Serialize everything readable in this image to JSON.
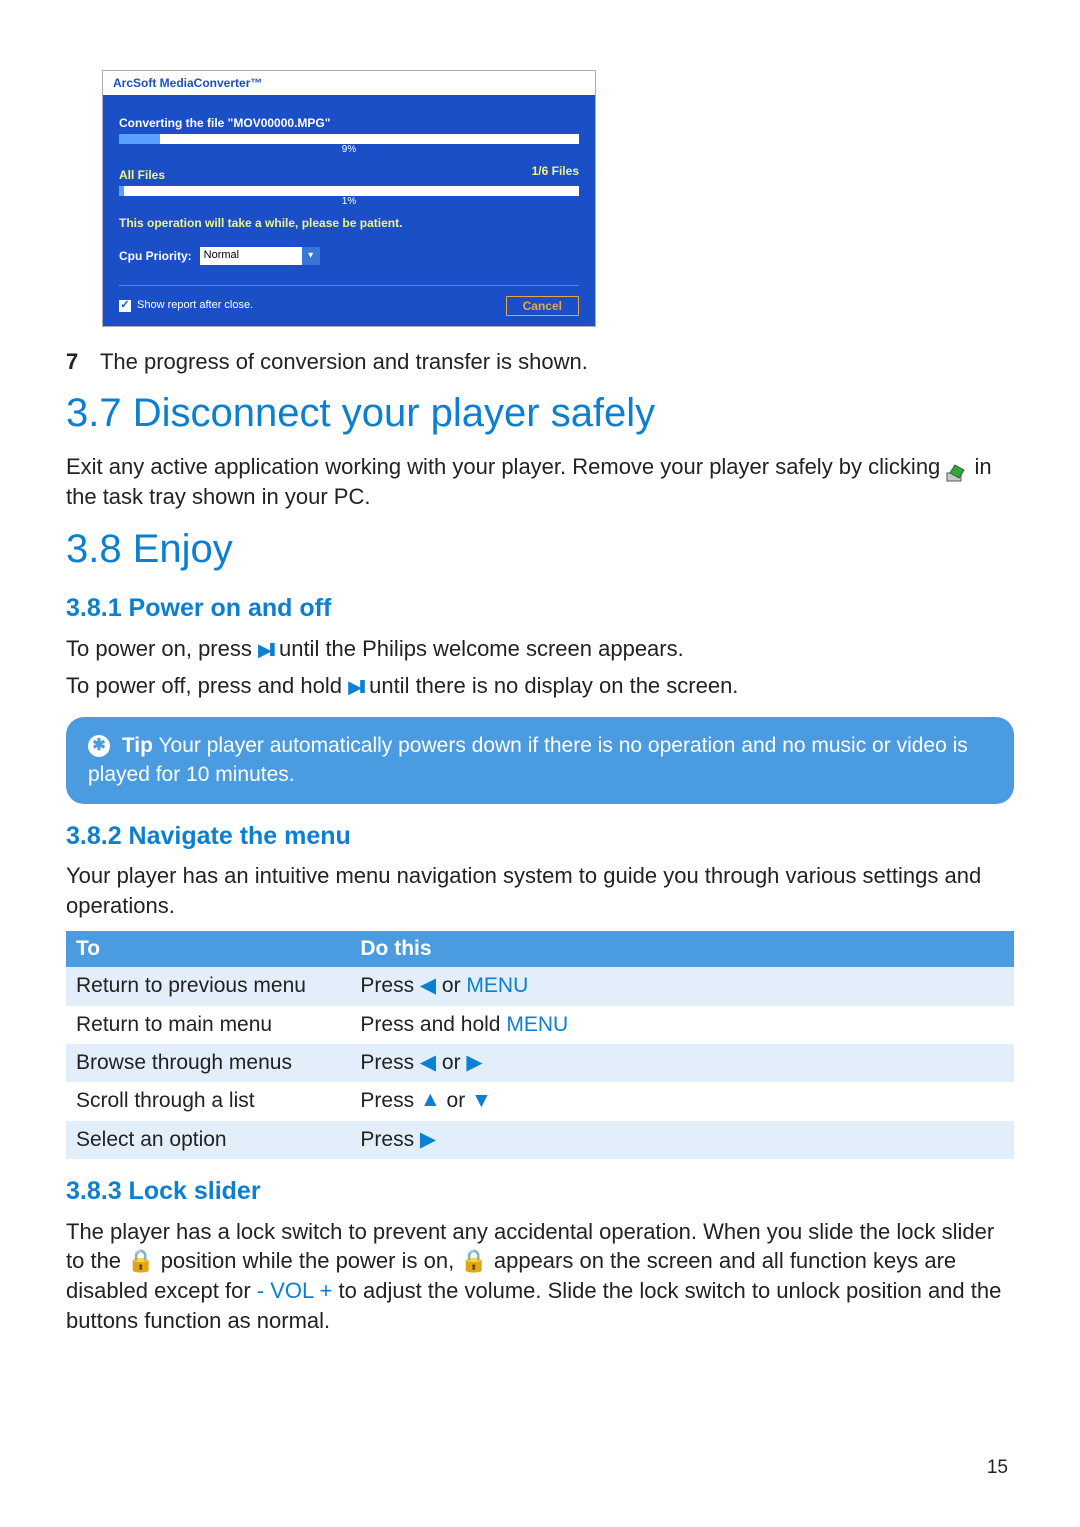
{
  "dialog": {
    "title": "ArcSoft MediaConverter™",
    "converting_label": "Converting the file \"MOV00000.MPG\"",
    "file_pct": "9%",
    "all_files_label": "All Files",
    "all_files_count": "1/6 Files",
    "all_pct": "1%",
    "note": "This operation will take a while, please be patient.",
    "cpu_label": "Cpu Priority:",
    "cpu_value": "Normal",
    "show_report": "Show report after close.",
    "cancel": "Cancel"
  },
  "step7": {
    "num": "7",
    "text": "The progress of conversion and transfer is shown."
  },
  "sec37": {
    "heading": "3.7  Disconnect your player safely",
    "para_a": "Exit any active application working with your player. Remove your player safely by clicking ",
    "para_b": " in the task tray shown in your PC."
  },
  "sec38": {
    "heading": "3.8  Enjoy"
  },
  "sec381": {
    "heading": "3.8.1 Power on and off",
    "on_a": "To power on, press ",
    "on_b": " until the Philips welcome screen appears.",
    "off_a": "To power off, press and hold ",
    "off_b": " until there is no display on the screen."
  },
  "tip": {
    "label": "Tip",
    "text": " Your player automatically powers down if there is no operation and no music or video is played for 10 minutes."
  },
  "sec382": {
    "heading": "3.8.2 Navigate the menu",
    "intro": "Your player has an intuitive menu navigation system to guide you through various settings and operations.",
    "th_to": "To",
    "th_do": "Do this",
    "r1_to": "Return to previous menu",
    "r1_do_a": "Press ",
    "r1_do_b": " or ",
    "menu_word": "MENU",
    "r2_to": "Return to main menu",
    "r2_do_a": "Press and hold ",
    "r3_to": "Browse through menus",
    "r3_do_a": "Press ",
    "r3_do_b": " or ",
    "r4_to": "Scroll through a list",
    "r4_do_a": "Press ",
    "r4_do_b": " or ",
    "r5_to": "Select an option",
    "r5_do_a": "Press "
  },
  "sec383": {
    "heading": "3.8.3 Lock slider",
    "p_a": "The player has a lock switch to prevent any accidental operation. When you slide the lock slider to the ",
    "p_b": " position while the power is on, ",
    "p_c": " appears on the screen and all function keys are disabled except for ",
    "vol": "- VOL +",
    "p_d": " to adjust the volume. Slide the lock switch to unlock position and the buttons function as normal."
  },
  "page_number": "15"
}
